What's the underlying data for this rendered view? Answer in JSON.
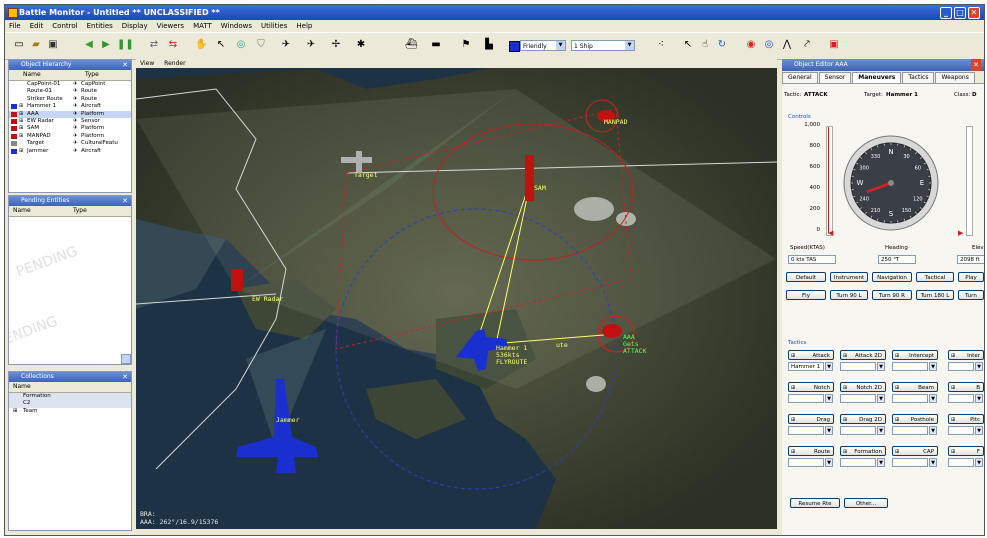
{
  "window": {
    "title": "Battle Monitor - Untitled  ** UNCLASSIFIED **",
    "min": "_",
    "max": "□",
    "close": "✕"
  },
  "menu": [
    "File",
    "Edit",
    "Control",
    "Entities",
    "Display",
    "Viewers",
    "MATT",
    "Windows",
    "Utilities",
    "Help"
  ],
  "toolbar": {
    "force_select": "Friendly",
    "unit_select": "1 Ship"
  },
  "object_hierarchy": {
    "title": "Object Hierarchy",
    "col_name": "Name",
    "col_type": "Type",
    "rows": [
      {
        "name": "CapPoint-01",
        "type": "CapPoint",
        "color": ""
      },
      {
        "name": "Route-01",
        "type": "Route",
        "color": ""
      },
      {
        "name": "Striker Route",
        "type": "Route",
        "color": ""
      },
      {
        "name": "Hammer 1",
        "type": "Aircraft",
        "color": "#1a2fd0"
      },
      {
        "name": "AAA",
        "type": "Platform",
        "color": "#c01010"
      },
      {
        "name": "EW Radar",
        "type": "Sensor",
        "color": "#c01010"
      },
      {
        "name": "SAM",
        "type": "Platform",
        "color": "#c01010"
      },
      {
        "name": "MANPAD",
        "type": "Platform",
        "color": "#c01010"
      },
      {
        "name": "Target",
        "type": "CulturalFeatu",
        "color": "#888888"
      },
      {
        "name": "Jammer",
        "type": "Aircraft",
        "color": "#1a2fd0"
      }
    ]
  },
  "pending_entities": {
    "title": "Pending Entities",
    "col_name": "Name",
    "col_type": "Type",
    "watermark1": "PENDING",
    "watermark2": "PENDING"
  },
  "collections": {
    "title": "Collections",
    "col_name": "Name",
    "items": [
      "Formation",
      "C2",
      "Team"
    ]
  },
  "map": {
    "menu_view": "View",
    "menu_render": "Render",
    "labels": {
      "target": "Target",
      "manpad": "MANPAD",
      "sam": "SAM",
      "ew_radar": "EW Radar",
      "hammer": "Hammer 1\n536kts\nFLYROUTE",
      "aaa": "AAA\nGets\nATTACK",
      "jammer": "Jammer",
      "ute": "ute"
    },
    "status_line1": "BRA:",
    "status_line2": "AAA: 262°/16.9/15376"
  },
  "editor": {
    "title": "Object Editor AAA",
    "tabs": [
      "General",
      "Sensor",
      "Maneuvers",
      "Tactics",
      "Weapons"
    ],
    "active_tab": "Maneuvers",
    "tactic_label": "Tactic:",
    "tactic_value": "ATTACK",
    "target_label": "Target:",
    "target_value": "Hammer 1",
    "class_label": "Class:",
    "class_value": "D",
    "controls_label": "Controls",
    "speed_scale": [
      "1,000",
      "800",
      "600",
      "400",
      "200",
      "0"
    ],
    "speed_label": "Speed(KTAS)",
    "speed_value": "0 kts TAS",
    "heading_label": "Heading",
    "heading_value": "250 °T",
    "elev_label": "Elev",
    "elev_value": "2098 ft",
    "compass_ticks": [
      "N",
      "30",
      "60",
      "E",
      "120",
      "150",
      "S",
      "210",
      "240",
      "W",
      "300",
      "330"
    ],
    "heading_deg": 250,
    "mode_buttons": [
      "Default",
      "Instrument",
      "Navigation",
      "Tactical",
      "Play"
    ],
    "maneuver_buttons": [
      "Fly",
      "Turn 90 L",
      "Turn 90 R",
      "Turn 180 L",
      "Turn"
    ],
    "tactics_label": "Tactics",
    "tactics": [
      [
        "Attack",
        "Attack 2D",
        "Intercept",
        "Inter"
      ],
      [
        "Notch",
        "Notch 2D",
        "Beam",
        "B"
      ],
      [
        "Drag",
        "Drag 2D",
        "Posthole",
        "Pitc"
      ],
      [
        "Route",
        "Formation",
        "CAP",
        "F"
      ]
    ],
    "attack_target": "Hammer 1",
    "resume_label": "Resume Rte",
    "other_label": "Other..."
  }
}
